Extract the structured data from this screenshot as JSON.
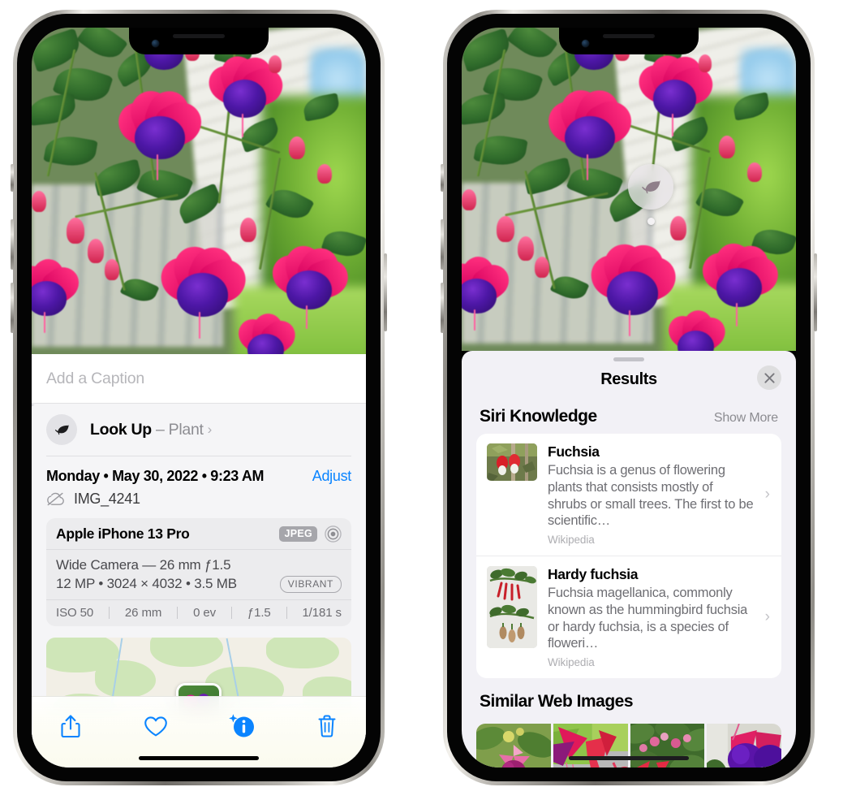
{
  "left_phone": {
    "name": "photos-info-screen",
    "photo": {
      "alt": "fuchsia-flowers-photo"
    },
    "caption_field": {
      "placeholder": "Add a Caption",
      "value": ""
    },
    "look_up": {
      "label_bold": "Look Up",
      "separator": " – ",
      "subject": "Plant",
      "chevron": "›",
      "icon": "leaf-icon",
      "sparkle": "✦"
    },
    "meta": {
      "date": "Monday • May 30, 2022 • 9:23 AM",
      "adjust_label": "Adjust",
      "filename": "IMG_4241",
      "cloud_icon": "cloud-slash-icon"
    },
    "exif": {
      "model": "Apple iPhone 13 Pro",
      "format_badge": "JPEG",
      "lens_icon": "camera-lens-icon",
      "line1": "Wide Camera — 26 mm ƒ1.5",
      "line2": "12 MP • 3024 × 4032 • 3.5 MB",
      "style_badge": "VIBRANT",
      "stats": [
        "ISO 50",
        "26 mm",
        "0 ev",
        "ƒ1.5",
        "1/181 s"
      ]
    },
    "map": {
      "name": "location-map",
      "pin": "photo-pin"
    },
    "toolbar": {
      "share": "share-icon",
      "favorite": "heart-icon",
      "info": "info-sparkle-icon",
      "delete": "trash-icon",
      "accent": "#0a84ff"
    }
  },
  "right_phone": {
    "name": "visual-look-up-results-screen",
    "photo": {
      "alt": "fuchsia-flowers-photo"
    },
    "vlu_badge": {
      "icon": "leaf-icon"
    },
    "sheet": {
      "title": "Results",
      "close_label": "✕",
      "sections": [
        {
          "title": "Siri Knowledge",
          "action": "Show More",
          "cards": [
            {
              "title": "Fuchsia",
              "description": "Fuchsia is a genus of flowering plants that consists mostly of shrubs or small trees. The first to be scientific…",
              "source": "Wikipedia",
              "thumb": "fuchsia-red-flowers-thumb",
              "chevron": "›"
            },
            {
              "title": "Hardy fuchsia",
              "description": "Fuchsia magellanica, commonly known as the hummingbird fuchsia or hardy fuchsia, is a species of floweri…",
              "source": "Wikipedia",
              "thumb": "hardy-fuchsia-branch-thumb",
              "chevron": "›"
            }
          ]
        },
        {
          "title": "Similar Web Images",
          "images": [
            "web-image-1-pink-fuchsia",
            "web-image-2-red-fuchsia",
            "web-image-3-fuchsia-bush",
            "web-image-4-purple-fuchsia"
          ]
        }
      ]
    }
  },
  "colors": {
    "ios_blue": "#0a84ff",
    "sheet_bg": "#f2f1f6",
    "card_bg": "#ffffff",
    "secondary_text": "#6e6e73",
    "tertiary_text": "#aeaeb2"
  }
}
